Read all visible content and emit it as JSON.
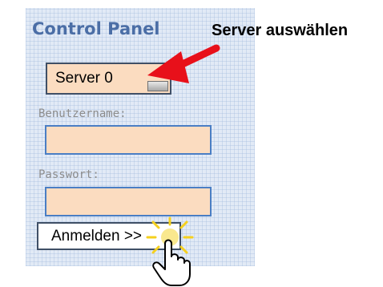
{
  "panel": {
    "title": "Control Panel",
    "server_select": {
      "selected_value": "Server 0",
      "arrow_icon": "dropdown-arrow-icon"
    },
    "username": {
      "label": "Benutzername:",
      "value": ""
    },
    "password": {
      "label": "Passwort:",
      "value": ""
    },
    "login_button": {
      "label": "Anmelden >>"
    }
  },
  "annotation": {
    "text": "Server auswählen",
    "arrow_icon": "red-arrow-icon",
    "arrow_color": "#e8101a",
    "cursor_icon": "hand-pointer-icon",
    "spark_icon": "click-spark-icon",
    "spark_color": "#f5d01e"
  },
  "colors": {
    "panel_background": "#e2eaf6",
    "title_color": "#4b6ea6",
    "field_background": "#fbdcc0",
    "field_border": "#4a7ec4"
  }
}
